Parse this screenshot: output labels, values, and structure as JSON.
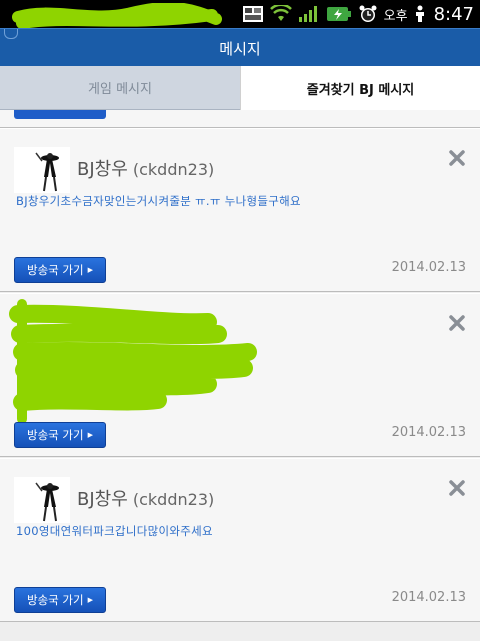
{
  "status_bar": {
    "ampm": "오후",
    "time": "8:47",
    "icons": [
      "image-icon",
      "wifi-icon",
      "signal-icon",
      "battery-icon",
      "alarm-icon",
      "person-icon"
    ]
  },
  "title_bar": {
    "title": "메시지"
  },
  "tabs": [
    {
      "label": "게임 메시지",
      "active": false
    },
    {
      "label": "즐겨찾기 BJ 메시지",
      "active": true
    }
  ],
  "messages": [
    {
      "bj_label": "BJ창우",
      "bj_id": "(ckddn23)",
      "text": "BJ창우기초수금자맞인는거시켜줄분 ㅠ.ㅠ 누나형들구해요",
      "button_label": "방송국 가기",
      "date": "2014.02.13"
    },
    {
      "bj_label": "",
      "bj_id": "",
      "text": "",
      "button_label": "방송국 가기",
      "date": "2014.02.13"
    },
    {
      "bj_label": "BJ창우",
      "bj_id": "(ckddn23)",
      "text": "100영대연워터파크갑니다많이와주세요",
      "button_label": "방송국 가기",
      "date": "2014.02.13"
    }
  ],
  "colors": {
    "title_bar": "#1a5ca8",
    "button": "#1f5dc8",
    "message_text": "#2f6fc9",
    "redaction": "#8fd400"
  }
}
